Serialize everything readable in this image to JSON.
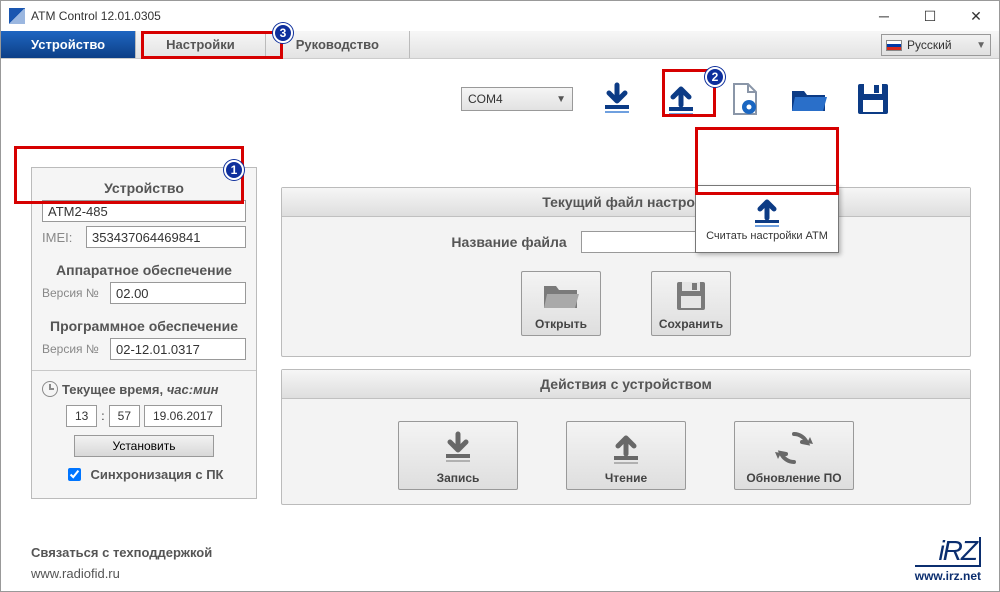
{
  "window": {
    "title": "ATM Control 12.01.0305"
  },
  "tabs": {
    "device": "Устройство",
    "settings": "Настройки",
    "manual": "Руководство"
  },
  "language": {
    "label": "Русский"
  },
  "com_port": "COM4",
  "sidebar": {
    "device_title": "Устройство",
    "device_model": "ATM2-485",
    "imei_label": "IMEI:",
    "imei": "353437064469841",
    "hw_title": "Аппаратное обеспечение",
    "version_label": "Версия №",
    "hw_version": "02.00",
    "sw_title": "Программное обеспечение",
    "sw_version": "02-12.01.0317",
    "time_title_prefix": "Текущее время, ",
    "time_title_em": "час:мин",
    "hour": "13",
    "minute": "57",
    "date": "19.06.2017",
    "set_btn": "Установить",
    "sync_label": "Синхронизация с ПК"
  },
  "panel1": {
    "title": "Текущий файл настроек",
    "file_label": "Название файла",
    "open": "Открыть",
    "save": "Сохранить"
  },
  "panel2": {
    "title": "Действия с устройством",
    "write": "Запись",
    "read": "Чтение",
    "update": "Обновление ПО"
  },
  "tooltip": {
    "text": "Считать настройки ATM"
  },
  "footer": {
    "support": "Связаться с техподдержкой",
    "url": "www.radiofid.ru"
  },
  "logo_url": "www.irz.net",
  "badges": {
    "b1": "1",
    "b2": "2",
    "b3": "3"
  }
}
